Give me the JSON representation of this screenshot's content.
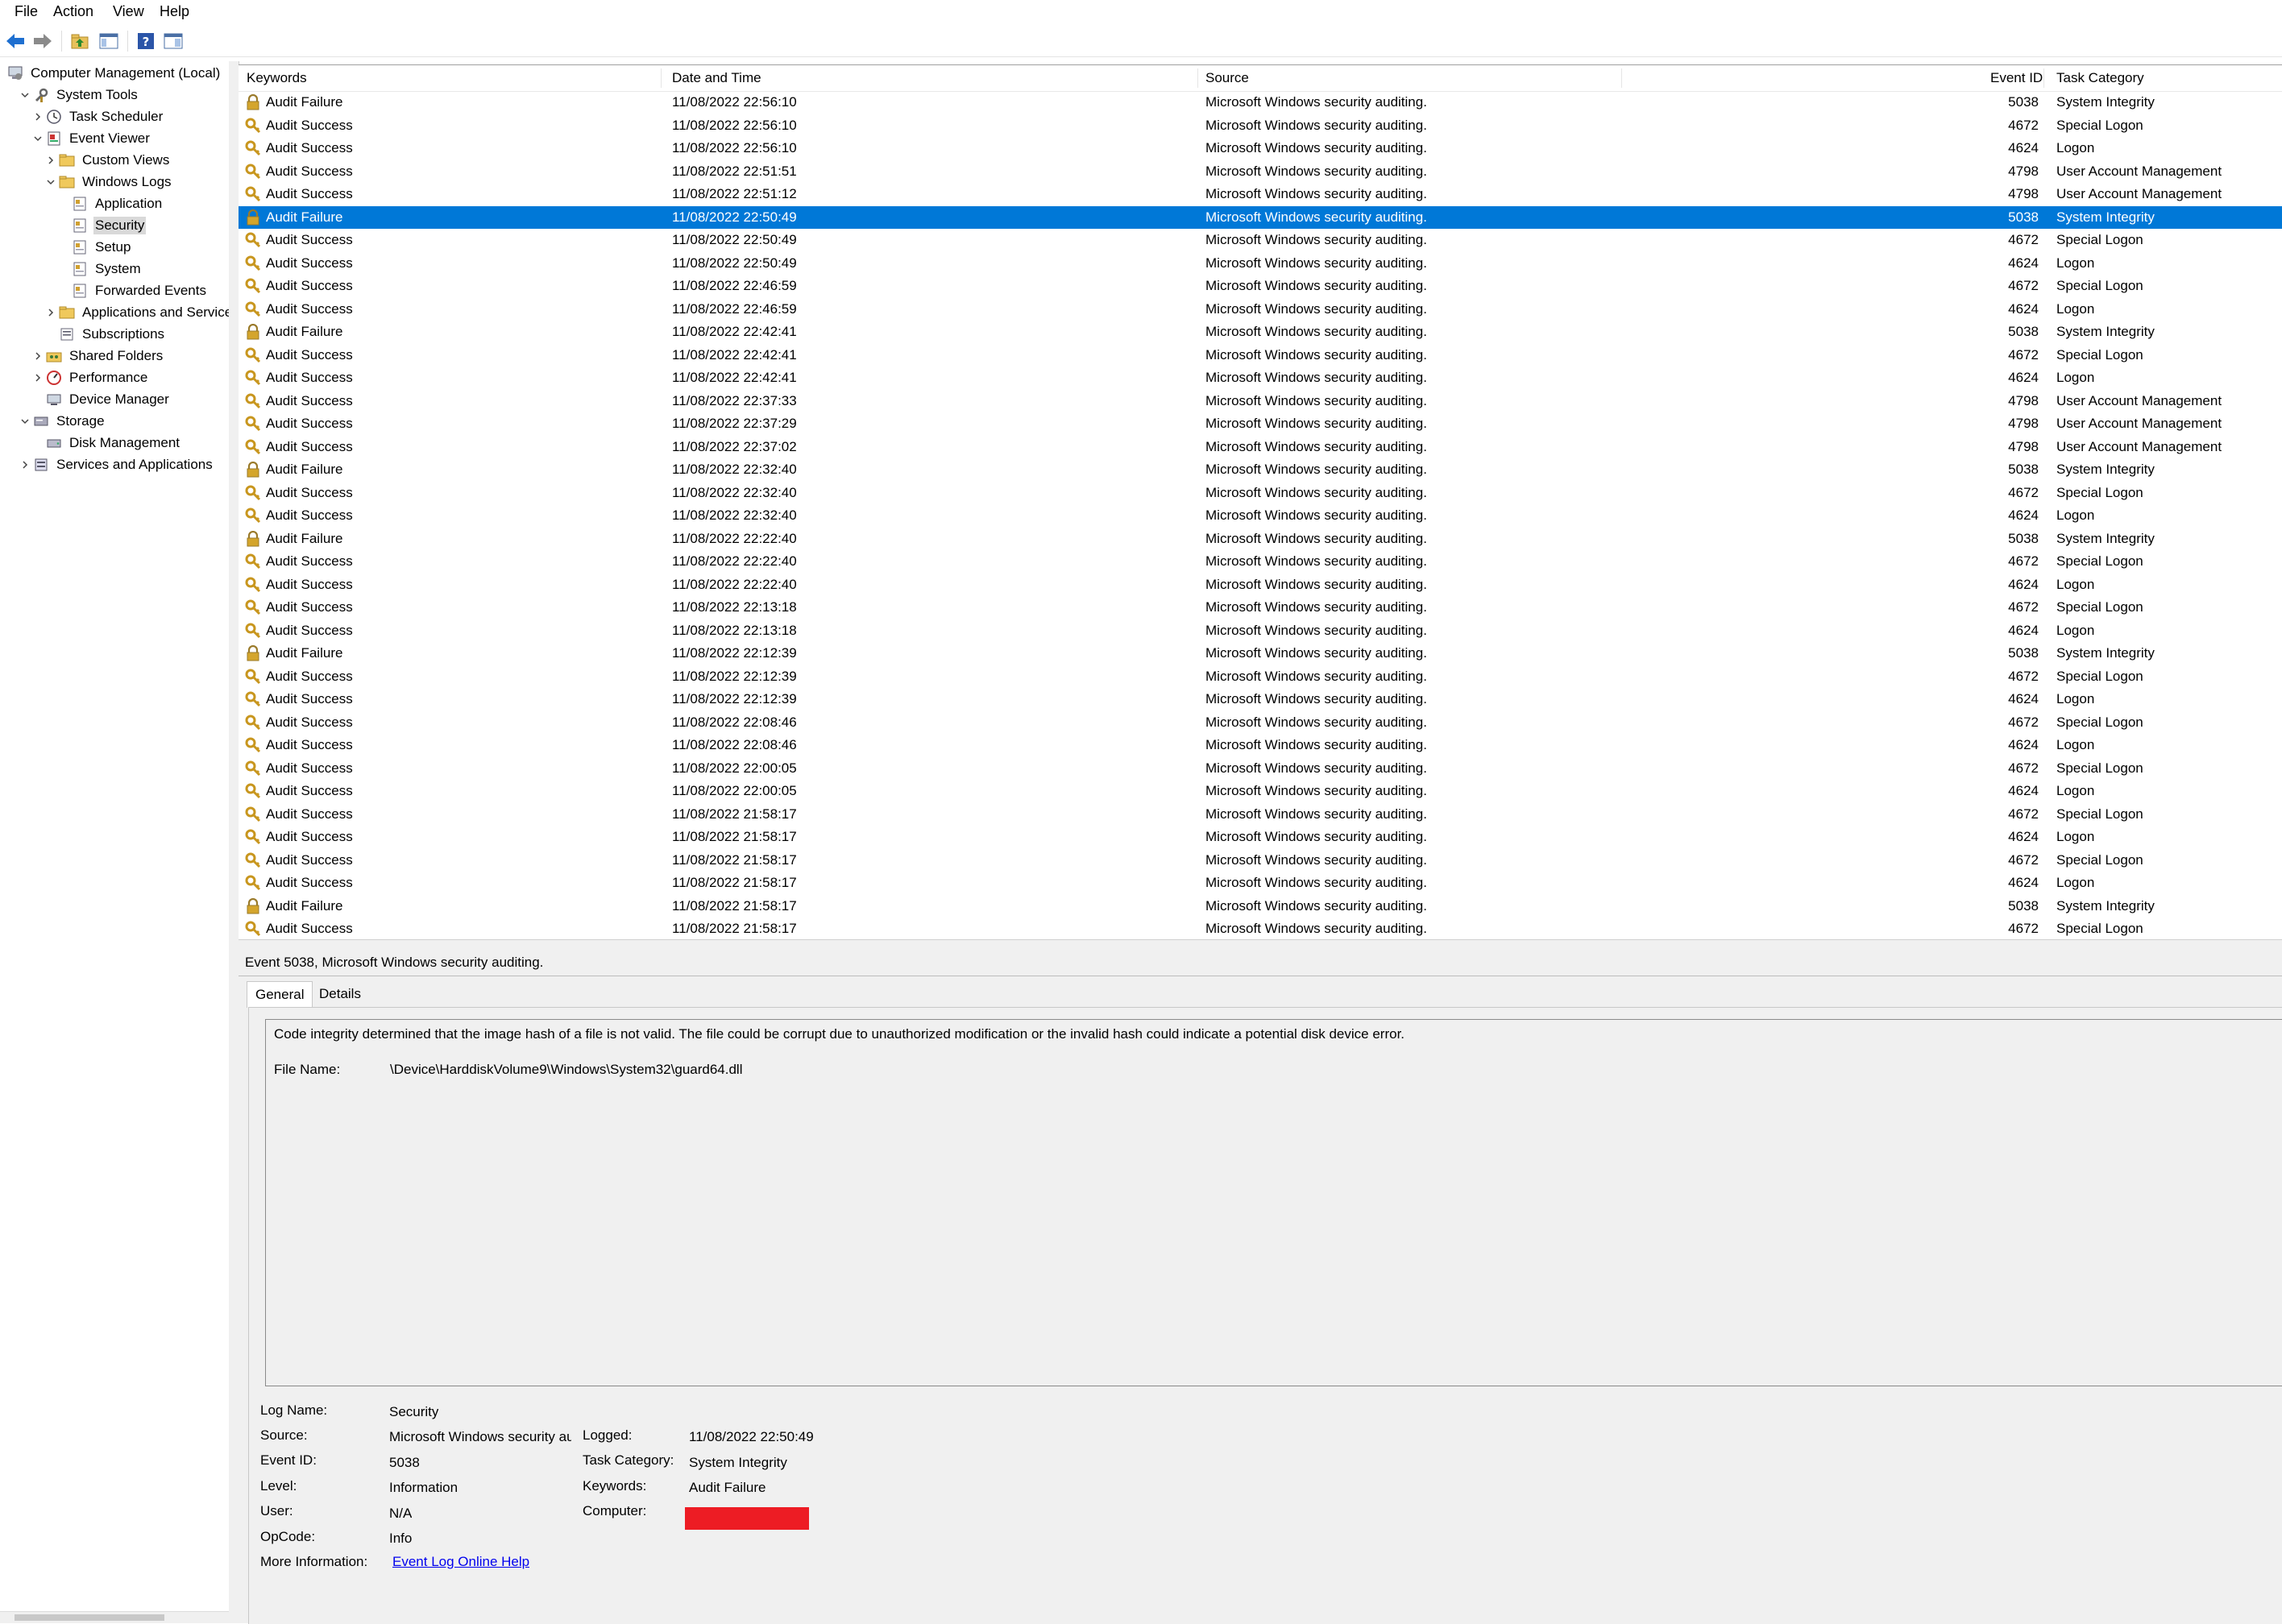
{
  "menu": [
    "File",
    "Action",
    "View",
    "Help"
  ],
  "toolbar": {
    "buttons": [
      "back-arrow-icon",
      "forward-arrow-icon",
      "up-folder-icon",
      "show-hide-console-tree-icon",
      "help-icon",
      "show-hide-action-pane-icon"
    ]
  },
  "tree": [
    {
      "label": "Computer Management (Local)",
      "icon": "computer-management-icon",
      "level": 0,
      "expander": ""
    },
    {
      "label": "System Tools",
      "icon": "system-tools-icon",
      "level": 1,
      "expander": "down"
    },
    {
      "label": "Task Scheduler",
      "icon": "clock-icon",
      "level": 2,
      "expander": "right"
    },
    {
      "label": "Event Viewer",
      "icon": "event-viewer-icon",
      "level": 2,
      "expander": "down"
    },
    {
      "label": "Custom Views",
      "icon": "folder-icon",
      "level": 3,
      "expander": "right"
    },
    {
      "label": "Windows Logs",
      "icon": "folder-icon",
      "level": 3,
      "expander": "down"
    },
    {
      "label": "Application",
      "icon": "log-icon",
      "level": 4,
      "expander": ""
    },
    {
      "label": "Security",
      "icon": "log-icon",
      "level": 4,
      "expander": "",
      "selected": true
    },
    {
      "label": "Setup",
      "icon": "log-icon",
      "level": 4,
      "expander": ""
    },
    {
      "label": "System",
      "icon": "log-icon",
      "level": 4,
      "expander": ""
    },
    {
      "label": "Forwarded Events",
      "icon": "log-icon",
      "level": 4,
      "expander": ""
    },
    {
      "label": "Applications and Services Logs",
      "icon": "folder-icon",
      "level": 3,
      "expander": "right"
    },
    {
      "label": "Subscriptions",
      "icon": "subscriptions-icon",
      "level": 3,
      "expander": ""
    },
    {
      "label": "Shared Folders",
      "icon": "shared-folders-icon",
      "level": 2,
      "expander": "right"
    },
    {
      "label": "Performance",
      "icon": "performance-icon",
      "level": 2,
      "expander": "right"
    },
    {
      "label": "Device Manager",
      "icon": "device-manager-icon",
      "level": 2,
      "expander": ""
    },
    {
      "label": "Storage",
      "icon": "storage-icon",
      "level": 1,
      "expander": "down"
    },
    {
      "label": "Disk Management",
      "icon": "disk-icon",
      "level": 2,
      "expander": ""
    },
    {
      "label": "Services and Applications",
      "icon": "services-icon",
      "level": 1,
      "expander": "right"
    }
  ],
  "list": {
    "columns": [
      "Keywords",
      "Date and Time",
      "Source",
      "Event ID",
      "Task Category"
    ],
    "rows": [
      {
        "kw": "Audit Failure",
        "dt": "11/08/2022 22:56:10",
        "src": "Microsoft Windows security auditing.",
        "id": "5038",
        "cat": "System Integrity"
      },
      {
        "kw": "Audit Success",
        "dt": "11/08/2022 22:56:10",
        "src": "Microsoft Windows security auditing.",
        "id": "4672",
        "cat": "Special Logon"
      },
      {
        "kw": "Audit Success",
        "dt": "11/08/2022 22:56:10",
        "src": "Microsoft Windows security auditing.",
        "id": "4624",
        "cat": "Logon"
      },
      {
        "kw": "Audit Success",
        "dt": "11/08/2022 22:51:51",
        "src": "Microsoft Windows security auditing.",
        "id": "4798",
        "cat": "User Account Management"
      },
      {
        "kw": "Audit Success",
        "dt": "11/08/2022 22:51:12",
        "src": "Microsoft Windows security auditing.",
        "id": "4798",
        "cat": "User Account Management"
      },
      {
        "kw": "Audit Failure",
        "dt": "11/08/2022 22:50:49",
        "src": "Microsoft Windows security auditing.",
        "id": "5038",
        "cat": "System Integrity",
        "selected": true
      },
      {
        "kw": "Audit Success",
        "dt": "11/08/2022 22:50:49",
        "src": "Microsoft Windows security auditing.",
        "id": "4672",
        "cat": "Special Logon"
      },
      {
        "kw": "Audit Success",
        "dt": "11/08/2022 22:50:49",
        "src": "Microsoft Windows security auditing.",
        "id": "4624",
        "cat": "Logon"
      },
      {
        "kw": "Audit Success",
        "dt": "11/08/2022 22:46:59",
        "src": "Microsoft Windows security auditing.",
        "id": "4672",
        "cat": "Special Logon"
      },
      {
        "kw": "Audit Success",
        "dt": "11/08/2022 22:46:59",
        "src": "Microsoft Windows security auditing.",
        "id": "4624",
        "cat": "Logon"
      },
      {
        "kw": "Audit Failure",
        "dt": "11/08/2022 22:42:41",
        "src": "Microsoft Windows security auditing.",
        "id": "5038",
        "cat": "System Integrity"
      },
      {
        "kw": "Audit Success",
        "dt": "11/08/2022 22:42:41",
        "src": "Microsoft Windows security auditing.",
        "id": "4672",
        "cat": "Special Logon"
      },
      {
        "kw": "Audit Success",
        "dt": "11/08/2022 22:42:41",
        "src": "Microsoft Windows security auditing.",
        "id": "4624",
        "cat": "Logon"
      },
      {
        "kw": "Audit Success",
        "dt": "11/08/2022 22:37:33",
        "src": "Microsoft Windows security auditing.",
        "id": "4798",
        "cat": "User Account Management"
      },
      {
        "kw": "Audit Success",
        "dt": "11/08/2022 22:37:29",
        "src": "Microsoft Windows security auditing.",
        "id": "4798",
        "cat": "User Account Management"
      },
      {
        "kw": "Audit Success",
        "dt": "11/08/2022 22:37:02",
        "src": "Microsoft Windows security auditing.",
        "id": "4798",
        "cat": "User Account Management"
      },
      {
        "kw": "Audit Failure",
        "dt": "11/08/2022 22:32:40",
        "src": "Microsoft Windows security auditing.",
        "id": "5038",
        "cat": "System Integrity"
      },
      {
        "kw": "Audit Success",
        "dt": "11/08/2022 22:32:40",
        "src": "Microsoft Windows security auditing.",
        "id": "4672",
        "cat": "Special Logon"
      },
      {
        "kw": "Audit Success",
        "dt": "11/08/2022 22:32:40",
        "src": "Microsoft Windows security auditing.",
        "id": "4624",
        "cat": "Logon"
      },
      {
        "kw": "Audit Failure",
        "dt": "11/08/2022 22:22:40",
        "src": "Microsoft Windows security auditing.",
        "id": "5038",
        "cat": "System Integrity"
      },
      {
        "kw": "Audit Success",
        "dt": "11/08/2022 22:22:40",
        "src": "Microsoft Windows security auditing.",
        "id": "4672",
        "cat": "Special Logon"
      },
      {
        "kw": "Audit Success",
        "dt": "11/08/2022 22:22:40",
        "src": "Microsoft Windows security auditing.",
        "id": "4624",
        "cat": "Logon"
      },
      {
        "kw": "Audit Success",
        "dt": "11/08/2022 22:13:18",
        "src": "Microsoft Windows security auditing.",
        "id": "4672",
        "cat": "Special Logon"
      },
      {
        "kw": "Audit Success",
        "dt": "11/08/2022 22:13:18",
        "src": "Microsoft Windows security auditing.",
        "id": "4624",
        "cat": "Logon"
      },
      {
        "kw": "Audit Failure",
        "dt": "11/08/2022 22:12:39",
        "src": "Microsoft Windows security auditing.",
        "id": "5038",
        "cat": "System Integrity"
      },
      {
        "kw": "Audit Success",
        "dt": "11/08/2022 22:12:39",
        "src": "Microsoft Windows security auditing.",
        "id": "4672",
        "cat": "Special Logon"
      },
      {
        "kw": "Audit Success",
        "dt": "11/08/2022 22:12:39",
        "src": "Microsoft Windows security auditing.",
        "id": "4624",
        "cat": "Logon"
      },
      {
        "kw": "Audit Success",
        "dt": "11/08/2022 22:08:46",
        "src": "Microsoft Windows security auditing.",
        "id": "4672",
        "cat": "Special Logon"
      },
      {
        "kw": "Audit Success",
        "dt": "11/08/2022 22:08:46",
        "src": "Microsoft Windows security auditing.",
        "id": "4624",
        "cat": "Logon"
      },
      {
        "kw": "Audit Success",
        "dt": "11/08/2022 22:00:05",
        "src": "Microsoft Windows security auditing.",
        "id": "4672",
        "cat": "Special Logon"
      },
      {
        "kw": "Audit Success",
        "dt": "11/08/2022 22:00:05",
        "src": "Microsoft Windows security auditing.",
        "id": "4624",
        "cat": "Logon"
      },
      {
        "kw": "Audit Success",
        "dt": "11/08/2022 21:58:17",
        "src": "Microsoft Windows security auditing.",
        "id": "4672",
        "cat": "Special Logon"
      },
      {
        "kw": "Audit Success",
        "dt": "11/08/2022 21:58:17",
        "src": "Microsoft Windows security auditing.",
        "id": "4624",
        "cat": "Logon"
      },
      {
        "kw": "Audit Success",
        "dt": "11/08/2022 21:58:17",
        "src": "Microsoft Windows security auditing.",
        "id": "4672",
        "cat": "Special Logon"
      },
      {
        "kw": "Audit Success",
        "dt": "11/08/2022 21:58:17",
        "src": "Microsoft Windows security auditing.",
        "id": "4624",
        "cat": "Logon"
      },
      {
        "kw": "Audit Failure",
        "dt": "11/08/2022 21:58:17",
        "src": "Microsoft Windows security auditing.",
        "id": "5038",
        "cat": "System Integrity"
      },
      {
        "kw": "Audit Success",
        "dt": "11/08/2022 21:58:17",
        "src": "Microsoft Windows security auditing.",
        "id": "4672",
        "cat": "Special Logon"
      }
    ]
  },
  "detail": {
    "title": "Event 5038, Microsoft Windows security auditing.",
    "tabs": [
      "General",
      "Details"
    ],
    "description": "Code integrity determined that the image hash of a file is not valid.  The file could be corrupt due to unauthorized modification or the invalid hash could indicate a potential disk device error.",
    "file_name_label": "File Name:",
    "file_name": "\\Device\\HarddiskVolume9\\Windows\\System32\\guard64.dll",
    "labels": {
      "log_name": "Log Name:",
      "source": "Source:",
      "event_id": "Event ID:",
      "level": "Level:",
      "user": "User:",
      "opcode": "OpCode:",
      "more_info": "More Information:",
      "logged": "Logged:",
      "task_category": "Task Category:",
      "keywords": "Keywords:",
      "computer": "Computer:"
    },
    "values": {
      "log_name": "Security",
      "source": "Microsoft Windows security auditing.",
      "event_id": "5038",
      "level": "Information",
      "user": "N/A",
      "opcode": "Info",
      "more_info_link": "Event Log Online Help",
      "logged": "11/08/2022 22:50:49",
      "task_category": "System Integrity",
      "keywords": "Audit Failure"
    }
  },
  "colors": {
    "selection": "#0078d7",
    "redaction": "#ed1c24",
    "key_icon": "#c8961e",
    "link": "#0000ee"
  }
}
